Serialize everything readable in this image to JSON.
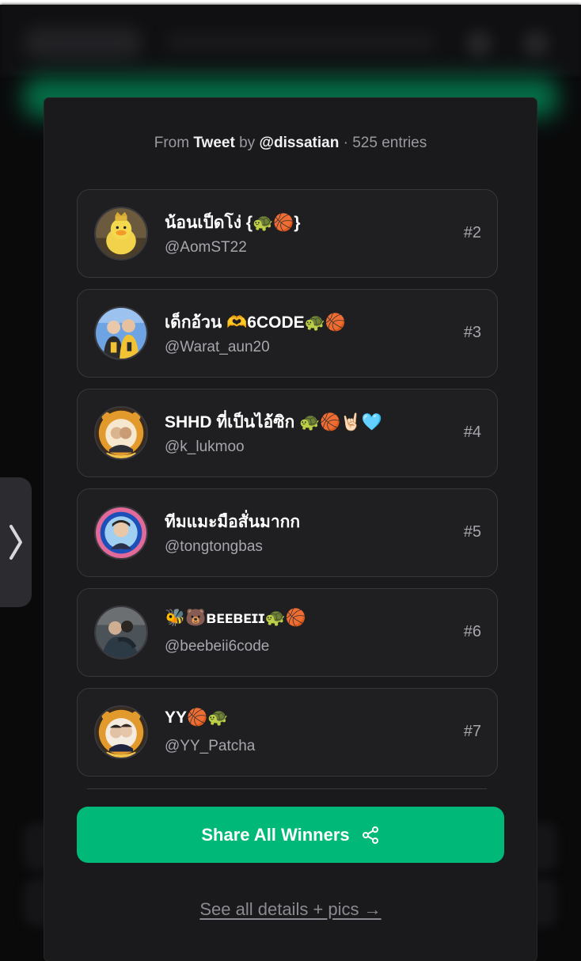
{
  "source": {
    "from_label": "From",
    "source_type": "Tweet",
    "by_label": "by",
    "author": "@dissatian",
    "entries": "· 525 entries"
  },
  "winners": [
    {
      "name": "น้อนเป็ดโง่ {🐢🏀}",
      "handle": "@AomST22",
      "rank": "#2",
      "avatar_icon": "yellow-duck-plush-avatar"
    },
    {
      "name": "เด็กอ้วน 🫶6CODE🐢🏀",
      "handle": "@Warat_aun20",
      "rank": "#3",
      "avatar_icon": "two-people-photo-avatar"
    },
    {
      "name": "SHHD ที่เป็นไอ้ซิก 🐢🏀🤘🏻🩵",
      "handle": "@k_lukmoo",
      "rank": "#4",
      "avatar_icon": "tiger-frame-avatar"
    },
    {
      "name": "ทีมแมะมือสั่นมากก",
      "handle": "@tongtongbas",
      "rank": "#5",
      "avatar_icon": "blue-circle-portrait-avatar"
    },
    {
      "name": "🐝🐻ʙᴇᴇʙᴇɪɪ🐢🏀",
      "handle": "@beebeii6code",
      "rank": "#6",
      "avatar_icon": "hug-photo-avatar"
    },
    {
      "name": "YY🏀🐢",
      "handle": "@YY_Patcha",
      "rank": "#7",
      "avatar_icon": "tiger-frame-couple-avatar"
    }
  ],
  "share_button": {
    "label": "Share All Winners",
    "icon": "share-icon"
  },
  "details_link": "See all details + pics →",
  "side_tab": {
    "icon": "chevron-right-icon"
  },
  "colors": {
    "accent": "#00b877",
    "card": "#1a1a1c",
    "entry": "#1f1f22",
    "text": "#ffffff",
    "muted": "#a6a6ac"
  }
}
